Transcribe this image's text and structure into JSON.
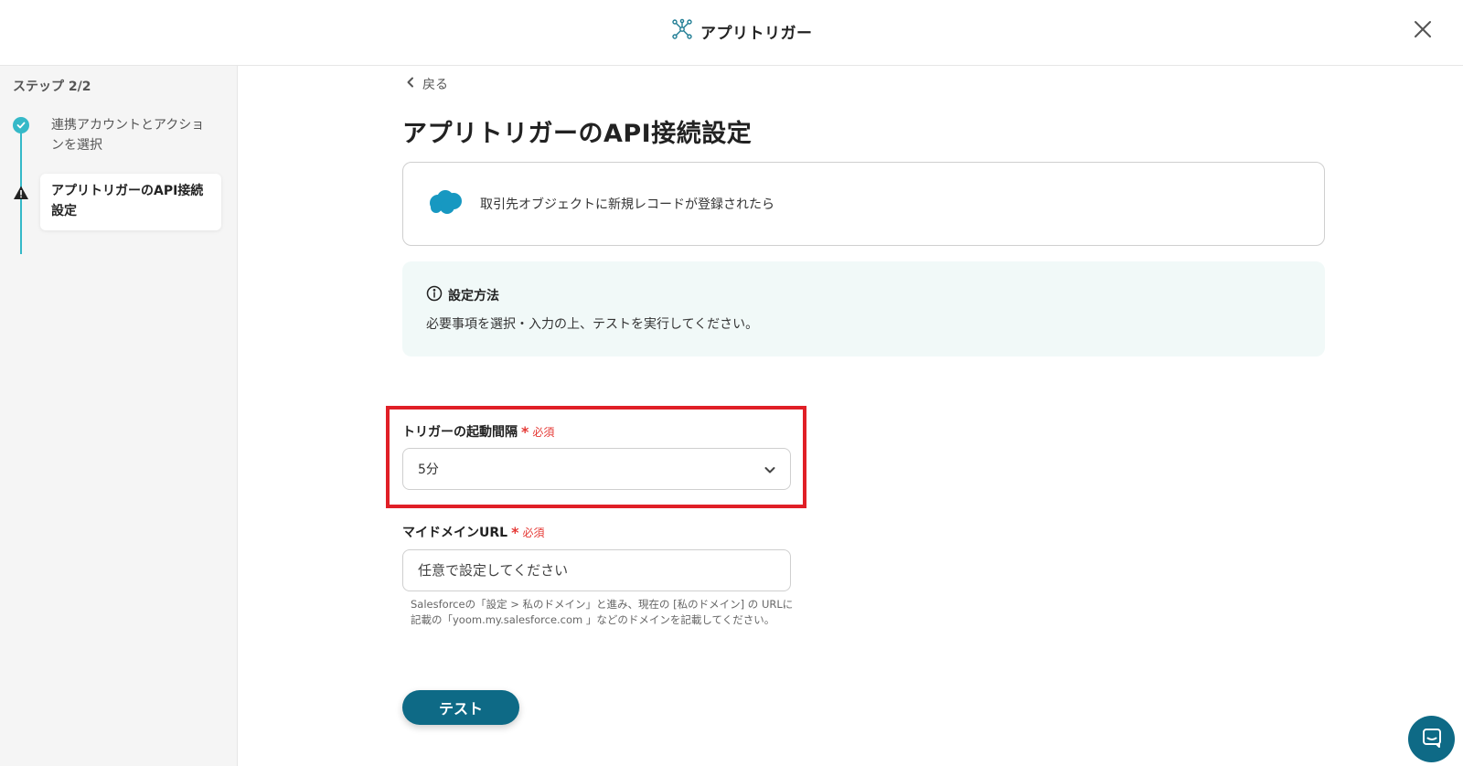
{
  "header": {
    "title": "アプリトリガー",
    "logo_icon": "network-nodes-icon",
    "close_icon": "close-icon"
  },
  "sidebar": {
    "step_label": "ステップ 2/2",
    "steps": [
      {
        "label": "連携アカウントとアクションを選択",
        "status": "completed",
        "icon": "check-circle-icon"
      },
      {
        "label": "アプリトリガーのAPI接続設定",
        "status": "current-warning",
        "icon": "warning-icon"
      }
    ]
  },
  "main": {
    "back_label": "戻る",
    "page_title": "アプリトリガーのAPI接続設定",
    "app_card": {
      "icon": "salesforce-cloud-icon",
      "text": "取引先オブジェクトに新規レコードが登録されたら"
    },
    "info": {
      "title": "設定方法",
      "body": "必要事項を選択・入力の上、テストを実行してください。"
    },
    "fields": {
      "interval": {
        "label": "トリガーの起動間隔",
        "required_mark": "*",
        "required_text": "必須",
        "value": "5分"
      },
      "domain": {
        "label": "マイドメインURL",
        "required_mark": "*",
        "required_text": "必須",
        "placeholder": "任意で設定してください",
        "help_line1": "Salesforceの「設定 > 私のドメイン」と進み、現在の [私のドメイン] の URLに",
        "help_line2": "記載の「yoom.my.salesforce.com 」などのドメインを記載してください。"
      }
    },
    "test_button": "テスト"
  },
  "colors": {
    "accent_teal": "#35b9c8",
    "primary_button": "#0e6a86",
    "required_red": "#e53935",
    "highlight_red": "#e01f26",
    "info_bg": "#f1f9f8",
    "salesforce_blue": "#1798c1"
  }
}
